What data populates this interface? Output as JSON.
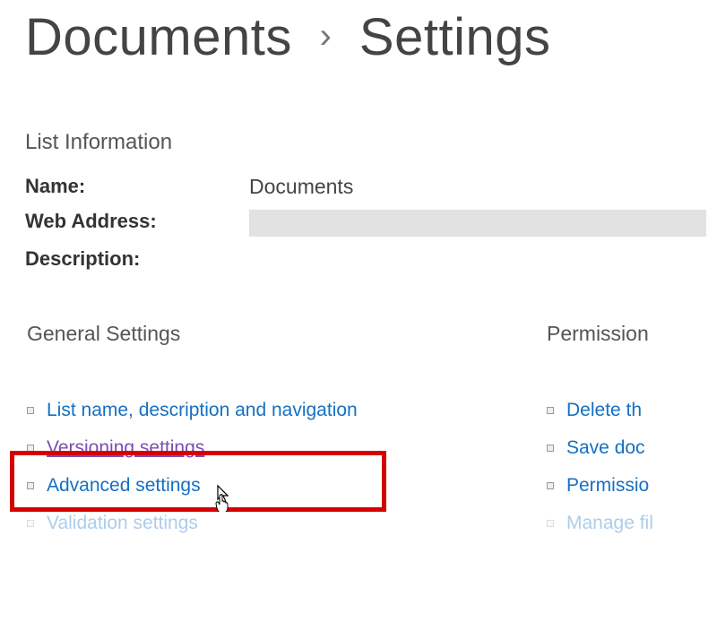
{
  "breadcrumb": {
    "part1": "Documents",
    "part2": "Settings"
  },
  "listInfo": {
    "heading": "List Information",
    "nameLabel": "Name:",
    "nameValue": "Documents",
    "webAddressLabel": "Web Address:",
    "descriptionLabel": "Description:"
  },
  "generalSettings": {
    "heading": "General Settings",
    "links": [
      "List name, description and navigation",
      "Versioning settings",
      "Advanced settings",
      "Validation settings"
    ]
  },
  "permissions": {
    "heading": "Permission",
    "links": [
      "Delete th",
      "Save doc",
      "Permissio",
      "Manage fil"
    ]
  }
}
